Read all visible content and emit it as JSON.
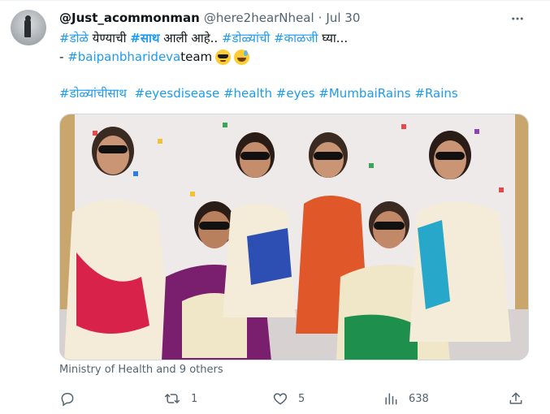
{
  "tweet": {
    "display_name": "@Just_acommonman",
    "handle": "@here2hearNheal",
    "separator": "·",
    "date": "Jul 30",
    "line1": {
      "tag1": "#डोळे",
      "text1": " येण्याची ",
      "tag2": "#साथ",
      "text2": " आली आहे.. ",
      "tag3": "#डोळ्यांची",
      "text3": " ",
      "tag4": "#काळजी",
      "text4": " घ्या..."
    },
    "line2": {
      "prefix": "- ",
      "tag": "#baipanbharideva",
      "suffix": " team"
    },
    "hashtags": [
      "#डोळ्यांचीसाथ",
      "#eyesdisease",
      "#health",
      "#eyes",
      "#MumbaiRains",
      "#Rains"
    ],
    "emojis": [
      "smiling-face-with-sunglasses",
      "grinning-face-with-sweat"
    ],
    "image_tags": "Ministry of Health and 9 others"
  },
  "actions": {
    "reply_count": "",
    "retweet_count": "1",
    "like_count": "5",
    "views_count": "638"
  },
  "colors": {
    "link": "#1d9bf0",
    "text": "#0f1419",
    "muted": "#536471"
  }
}
